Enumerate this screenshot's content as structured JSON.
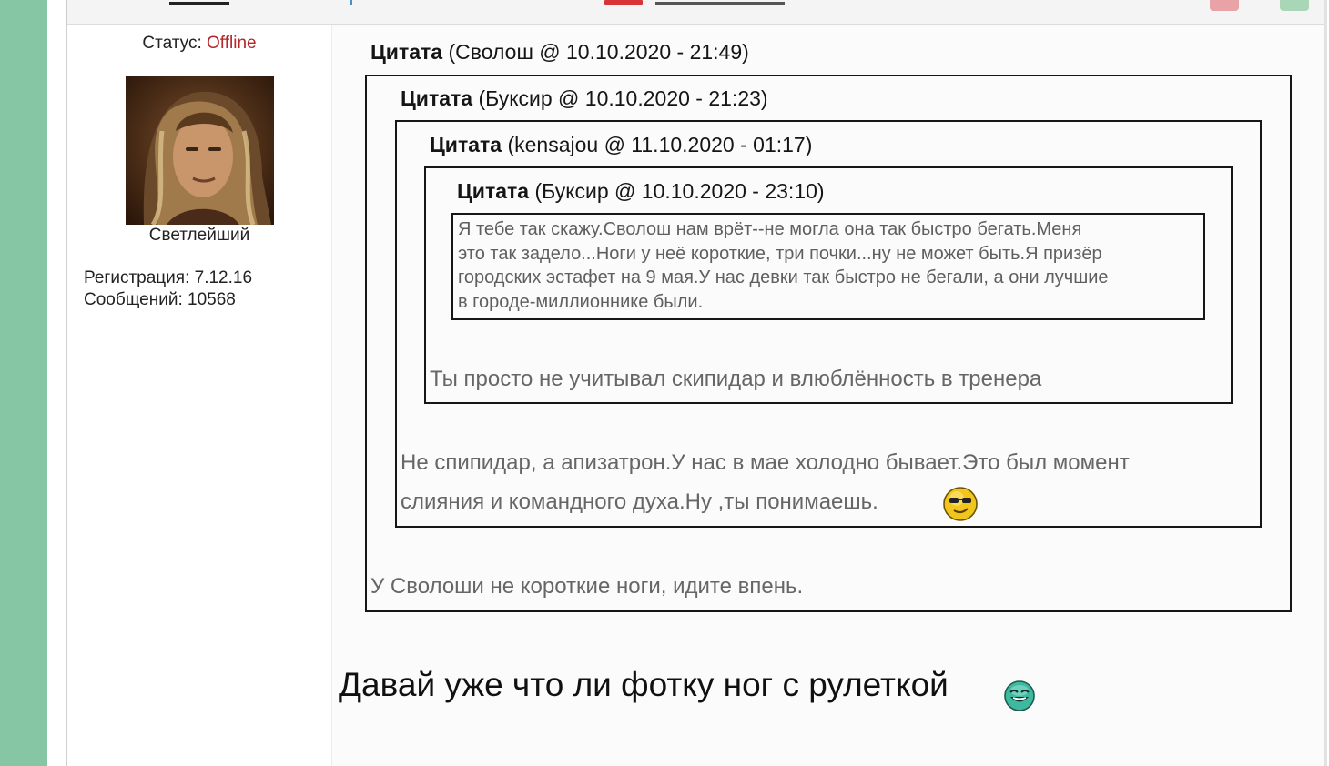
{
  "profile": {
    "status_label": "Статус:",
    "status_value": "Offline",
    "rank": "Светлейший",
    "registration": "Регистрация: 7.12.16",
    "messages": "Сообщений: 10568"
  },
  "quotes": {
    "q1": {
      "label": "Цитата",
      "meta": "(Сволош @ 10.10.2020 - 21:49)"
    },
    "q2": {
      "label": "Цитата",
      "meta": "(Буксир @ 10.10.2020 - 21:23)"
    },
    "q3": {
      "label": "Цитата",
      "meta": "(kensajou @ 11.10.2020 - 01:17)"
    },
    "q4": {
      "label": "Цитата",
      "meta": "(Буксир @ 10.10.2020 - 23:10)",
      "lines": [
        "Я тебе так скажу.Сволош нам врёт--не могла она так быстро бегать.Меня",
        "это так задело...Ноги у неё короткие, три почки...ну не может быть.Я призёр",
        "городских эстафет на 9 мая.У нас девки так быстро не бегали, а они лучшие",
        "в городе-миллионнике были."
      ]
    },
    "reply_q3": "Ты просто не учитывал скипидар и влюблённость в тренера",
    "reply_q2_line1": "Не спипидар, а апизатрон.У нас в мае холодно бывает.Это был момент",
    "reply_q2_line2": "слияния и командного духа.Ну ,ты понимаешь.",
    "reply_q1": "У Сволоши не короткие ноги, идите впень."
  },
  "post": {
    "text": "Давай уже что ли фотку ног с рулеткой"
  },
  "icons": {
    "smiley_cool": "smiley-cool-icon",
    "smiley_laugh": "smiley-laugh-icon"
  },
  "colors": {
    "left_strip": "#86c6a4",
    "offline": "#b3262a",
    "quote_border": "#161616",
    "quote_text": "#666666"
  }
}
